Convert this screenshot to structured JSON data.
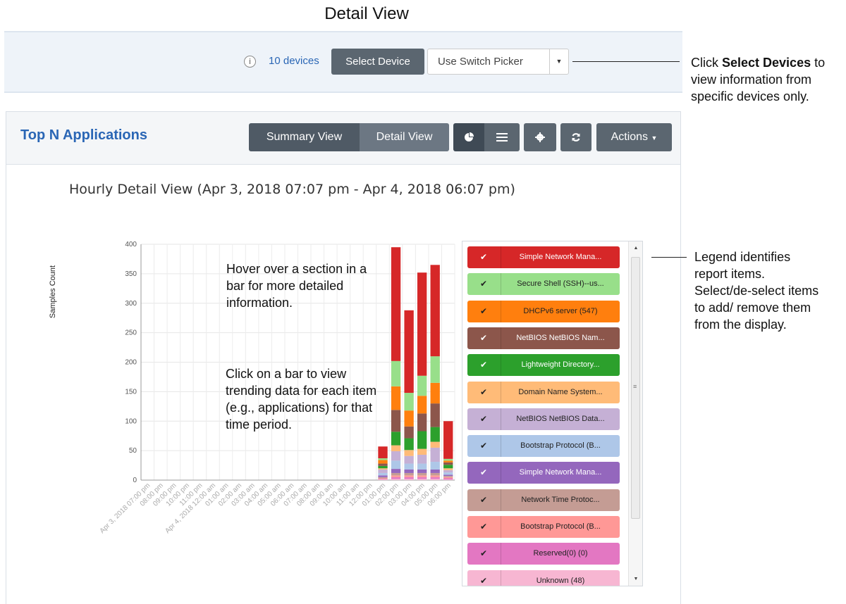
{
  "page_title": "Detail View",
  "device_bar": {
    "info_icon": "info-icon",
    "devices_link": "10 devices",
    "select_device_label": "Select Device",
    "switch_picker_label": "Use Switch Picker"
  },
  "panel": {
    "title": "Top N Applications",
    "summary_view_label": "Summary View",
    "detail_view_label": "Detail View",
    "actions_label": "Actions"
  },
  "chart_title": "Hourly Detail View (Apr 3, 2018 07:07 pm - Apr 4, 2018 06:07 pm)",
  "hints": {
    "hover": "Hover over a section in a bar for more detailed information.",
    "click": "Click on a bar to view trending data for each item (e.g., applications) for that time period."
  },
  "callouts": {
    "select_devices_pre": "Click ",
    "select_devices_bold": "Select Devices",
    "select_devices_post": " to view information from specific devices only.",
    "legend": "Legend identifies report items. Select/de-select items to add/ remove them from the display."
  },
  "legend": [
    {
      "label": "Simple Network Mana...",
      "color": "#d62728",
      "text_color": "#ffffff"
    },
    {
      "label": "Secure Shell (SSH)--us...",
      "color": "#98df8a",
      "text_color": "#222222"
    },
    {
      "label": "DHCPv6 server (547)",
      "color": "#ff7f0e",
      "text_color": "#222222"
    },
    {
      "label": "NetBIOS NetBIOS Nam...",
      "color": "#8c564b",
      "text_color": "#ffffff"
    },
    {
      "label": "Lightweight Directory...",
      "color": "#2ca02c",
      "text_color": "#ffffff"
    },
    {
      "label": "Domain Name System...",
      "color": "#ffbb78",
      "text_color": "#222222"
    },
    {
      "label": "NetBIOS NetBIOS Data...",
      "color": "#c5b0d5",
      "text_color": "#222222"
    },
    {
      "label": "Bootstrap Protocol (B...",
      "color": "#aec7e8",
      "text_color": "#222222"
    },
    {
      "label": "Simple Network Mana...",
      "color": "#9467bd",
      "text_color": "#ffffff"
    },
    {
      "label": "Network Time Protoc...",
      "color": "#c49c94",
      "text_color": "#222222"
    },
    {
      "label": "Bootstrap Protocol (B...",
      "color": "#ff9896",
      "text_color": "#222222"
    },
    {
      "label": "Reserved(0) (0)",
      "color": "#e377c2",
      "text_color": "#222222"
    },
    {
      "label": "Unknown (48)",
      "color": "#f7b6d2",
      "text_color": "#222222"
    }
  ],
  "chart_data": {
    "type": "bar",
    "stacked": true,
    "ylabel": "Samples Count",
    "ylim": [
      0,
      400
    ],
    "yticks": [
      0,
      50,
      100,
      150,
      200,
      250,
      300,
      350,
      400
    ],
    "grid": true,
    "categories": [
      "Apr 3, 2018 07:00 pm",
      "08:00 pm",
      "09:00 pm",
      "10:00 pm",
      "11:00 pm",
      "Apr 4, 2018 12:00 am",
      "01:00 am",
      "02:00 am",
      "03:00 am",
      "04:00 am",
      "05:00 am",
      "06:00 am",
      "07:00 am",
      "08:00 am",
      "09:00 am",
      "10:00 am",
      "11:00 am",
      "12:00 pm",
      "01:00 pm",
      "02:00 pm",
      "03:00 pm",
      "04:00 pm",
      "05:00 pm",
      "06:00 pm"
    ],
    "series": [
      {
        "name": "Unknown (48)",
        "color": "#f7b6d2",
        "values": [
          0,
          0,
          0,
          0,
          0,
          0,
          0,
          0,
          0,
          0,
          0,
          0,
          0,
          0,
          0,
          0,
          0,
          0,
          1,
          2,
          2,
          2,
          2,
          1
        ]
      },
      {
        "name": "Reserved(0) (0)",
        "color": "#e377c2",
        "values": [
          0,
          0,
          0,
          0,
          0,
          0,
          0,
          0,
          0,
          0,
          0,
          0,
          0,
          0,
          0,
          0,
          0,
          0,
          1,
          3,
          3,
          3,
          3,
          2
        ]
      },
      {
        "name": "Bootstrap Protocol (B...",
        "color": "#ff9896",
        "values": [
          0,
          0,
          0,
          0,
          0,
          0,
          0,
          0,
          0,
          0,
          0,
          0,
          0,
          0,
          0,
          0,
          0,
          0,
          1,
          3,
          3,
          3,
          3,
          2
        ]
      },
      {
        "name": "Network Time Protoc...",
        "color": "#c49c94",
        "values": [
          0,
          0,
          0,
          0,
          0,
          0,
          0,
          0,
          0,
          0,
          0,
          0,
          0,
          0,
          0,
          0,
          0,
          0,
          2,
          4,
          4,
          4,
          4,
          2
        ]
      },
      {
        "name": "Simple Network Mana...",
        "color": "#9467bd",
        "values": [
          0,
          0,
          0,
          0,
          0,
          0,
          0,
          0,
          0,
          0,
          0,
          0,
          0,
          0,
          0,
          0,
          0,
          0,
          3,
          7,
          6,
          6,
          6,
          2
        ]
      },
      {
        "name": "Bootstrap Protocol (B...",
        "color": "#aec7e8",
        "values": [
          0,
          0,
          0,
          0,
          0,
          0,
          0,
          0,
          0,
          0,
          0,
          0,
          0,
          0,
          0,
          0,
          0,
          0,
          4,
          14,
          10,
          10,
          13,
          4
        ]
      },
      {
        "name": "NetBIOS NetBIOS Data...",
        "color": "#c5b0d5",
        "values": [
          0,
          0,
          0,
          0,
          0,
          0,
          0,
          0,
          0,
          0,
          0,
          0,
          0,
          0,
          0,
          0,
          0,
          0,
          6,
          16,
          13,
          15,
          24,
          4
        ]
      },
      {
        "name": "Domain Name System...",
        "color": "#ffbb78",
        "values": [
          0,
          0,
          0,
          0,
          0,
          0,
          0,
          0,
          0,
          0,
          0,
          0,
          0,
          0,
          0,
          0,
          0,
          0,
          2,
          10,
          10,
          10,
          10,
          3
        ]
      },
      {
        "name": "Lightweight Directory...",
        "color": "#2ca02c",
        "values": [
          0,
          0,
          0,
          0,
          0,
          0,
          0,
          0,
          0,
          0,
          0,
          0,
          0,
          0,
          0,
          0,
          0,
          0,
          4,
          23,
          20,
          30,
          25,
          6
        ]
      },
      {
        "name": "NetBIOS NetBIOS Nam...",
        "color": "#8c564b",
        "values": [
          0,
          0,
          0,
          0,
          0,
          0,
          0,
          0,
          0,
          0,
          0,
          0,
          0,
          0,
          0,
          0,
          0,
          0,
          4,
          37,
          20,
          30,
          40,
          4
        ]
      },
      {
        "name": "DHCPv6 server (547)",
        "color": "#ff7f0e",
        "values": [
          0,
          0,
          0,
          0,
          0,
          0,
          0,
          0,
          0,
          0,
          0,
          0,
          0,
          0,
          0,
          0,
          0,
          0,
          6,
          40,
          27,
          30,
          35,
          3
        ]
      },
      {
        "name": "Secure Shell (SSH)--us...",
        "color": "#98df8a",
        "values": [
          0,
          0,
          0,
          0,
          0,
          0,
          0,
          0,
          0,
          0,
          0,
          0,
          0,
          0,
          0,
          0,
          0,
          0,
          3,
          43,
          30,
          34,
          45,
          3
        ]
      },
      {
        "name": "Simple Network Mana...",
        "color": "#d62728",
        "values": [
          0,
          0,
          0,
          0,
          0,
          0,
          0,
          0,
          0,
          0,
          0,
          0,
          0,
          0,
          0,
          0,
          0,
          0,
          20,
          193,
          140,
          175,
          155,
          64
        ]
      }
    ]
  }
}
